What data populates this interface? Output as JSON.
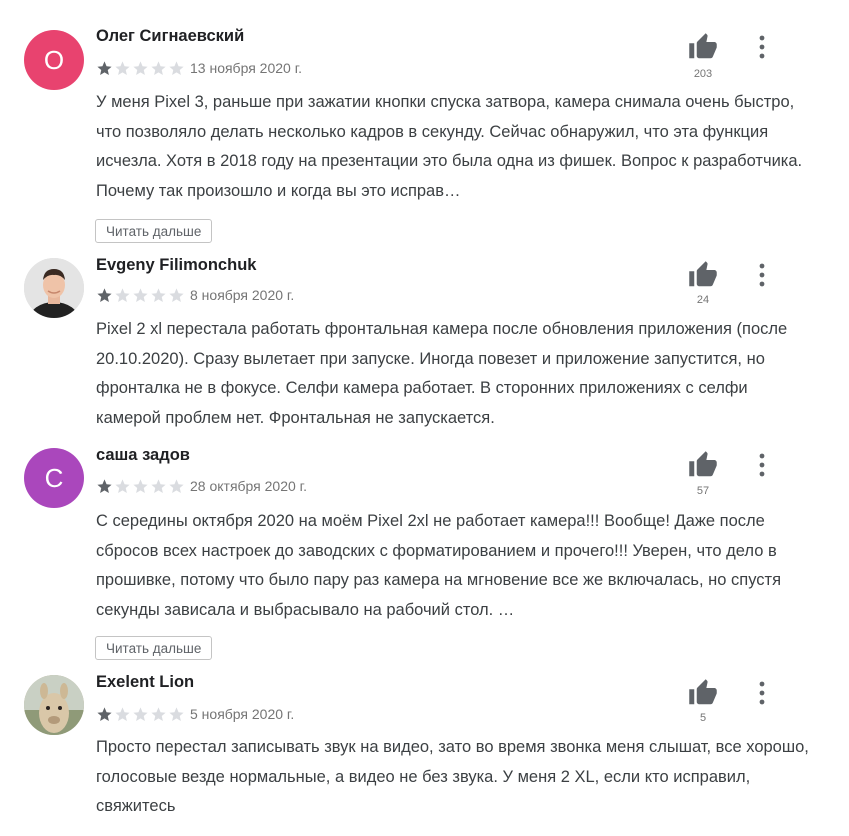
{
  "reviews": [
    {
      "author": "Олег Сигнаевский",
      "avatar_letter": "О",
      "avatar_color": "#e8436f",
      "rating": 1,
      "date": "13 ноября 2020 г.",
      "likes": "203",
      "text": "У меня Pixel 3, раньше при зажатии кнопки спуска затвора, камера снимала очень быстро, что позволяло делать несколько кадров в секунду. Сейчас обнаружил, что эта функция исчезла. Хотя в 2018 году на презентации это была одна из фишек. Вопрос к разработчика. Почему так произошло и когда вы это исправ…",
      "read_more": "Читать дальше"
    },
    {
      "author": "Evgeny Filimonchuk",
      "avatar_letter": "",
      "avatar_color": "#d7d7d7",
      "avatar_icon": "person-photo",
      "rating": 1,
      "date": "8 ноября 2020 г.",
      "likes": "24",
      "text": "Pixel 2 xl перестала работать фронтальная камера после обновления приложения (после 20.10.2020). Сразу вылетает при запуске. Иногда повезет и приложение запустится, но фронталка не в фокусе. Селфи камера работает. В сторонних приложениях с селфи камерой проблем нет. Фронтальная не запускается.",
      "read_more": ""
    },
    {
      "author": "саша задов",
      "avatar_letter": "С",
      "avatar_color": "#aa47bc",
      "rating": 1,
      "date": "28 октября 2020 г.",
      "likes": "57",
      "text": "С середины октября 2020 на моём Pixel 2xl не работает камера!!! Вообще! Даже после сбросов всех настроек до заводских с форматированием и прочего!!! Уверен, что дело в прошивке, потому что было пару раз камера на мгновение все же включалась, но спустя секунды зависала и выбрасывало на рабочий стол. …",
      "read_more": "Читать дальше"
    },
    {
      "author": "Exelent Lion",
      "avatar_letter": "",
      "avatar_color": "#b9ab8f",
      "avatar_icon": "llama-photo",
      "rating": 1,
      "date": "5 ноября 2020 г.",
      "likes": "5",
      "text": "Просто перестал записывать звук на видео, зато во время звонка меня слышат, все хорошо, голосовые везде нормальные, а видео не без звука. У меня 2 XL, если кто исправил, свяжитесь",
      "read_more": ""
    }
  ],
  "colors": {
    "star_filled": "#5f6368",
    "star_empty": "#dadce0",
    "icon": "#5f6368"
  }
}
